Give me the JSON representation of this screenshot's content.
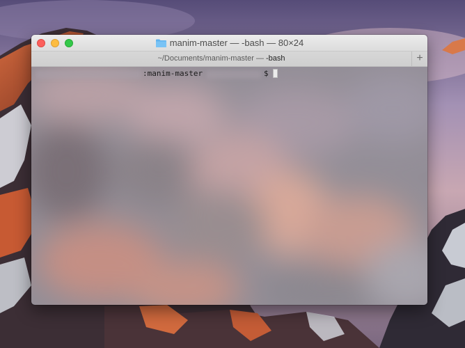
{
  "window": {
    "title": "manim-master — -bash — 80×24",
    "traffic_lights": {
      "close_color": "#fc605c",
      "minimize_color": "#fdbc40",
      "maximize_color": "#34c84a"
    },
    "title_icon": "folder-icon"
  },
  "tab": {
    "path_prefix": "~/Documents/manim-master — ",
    "process": "-bash",
    "new_tab_icon": "plus-icon",
    "new_tab_label": "+"
  },
  "terminal": {
    "prompt_directory": ":manim-master",
    "prompt_symbol": "$",
    "background_style": "translucent-blurred"
  }
}
